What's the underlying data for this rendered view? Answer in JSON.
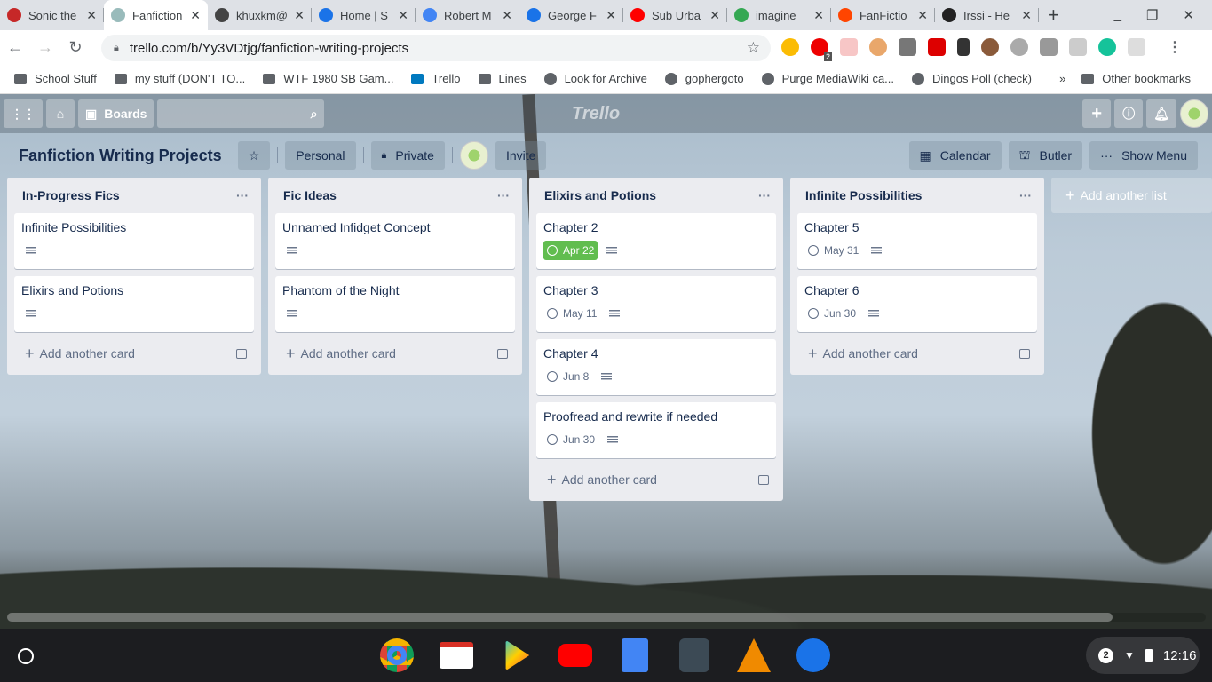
{
  "browser": {
    "tabs": [
      {
        "title": "Sonic the",
        "color": "#c62828"
      },
      {
        "title": "Fanfiction",
        "color": "#9bb",
        "active": true
      },
      {
        "title": "khuxkm@",
        "color": "#444"
      },
      {
        "title": "Home | S",
        "color": "#1a73e8"
      },
      {
        "title": "Robert M",
        "color": "#4285f4"
      },
      {
        "title": "George F",
        "color": "#1a73e8"
      },
      {
        "title": "Sub Urba",
        "color": "#ff0000"
      },
      {
        "title": "imagine",
        "color": "#34a853"
      },
      {
        "title": "FanFictio",
        "color": "#ff4500"
      },
      {
        "title": "Irssi - He",
        "color": "#222"
      }
    ],
    "url": "trello.com/b/Yy3VDtjg/fanfiction-writing-projects",
    "extension_badge": "2",
    "bookmarks": [
      {
        "label": "School Stuff",
        "icon": "folder-icon"
      },
      {
        "label": "my stuff (DON'T TO...",
        "icon": "folder-icon"
      },
      {
        "label": "WTF 1980 SB Gam...",
        "icon": "folder-icon"
      },
      {
        "label": "Trello",
        "icon": "trello-icon"
      },
      {
        "label": "Lines",
        "icon": "lines-icon"
      },
      {
        "label": "Look for Archive",
        "icon": "globe-icon"
      },
      {
        "label": "gophergoto",
        "icon": "globe-icon"
      },
      {
        "label": "Purge MediaWiki ca...",
        "icon": "globe-icon"
      },
      {
        "label": "Dingos Poll (check)",
        "icon": "globe-icon"
      }
    ],
    "overflow": "»",
    "other_bookmarks": "Other bookmarks"
  },
  "trello": {
    "boards_label": "Boards",
    "logo": "Trello",
    "board_title": "Fanfiction Writing Projects",
    "team": "Personal",
    "visibility": "Private",
    "invite": "Invite",
    "calendar": "Calendar",
    "butler": "Butler",
    "show_menu": "Show Menu",
    "add_card": "Add another card",
    "add_list": "Add another list",
    "lists": [
      {
        "title": "In-Progress Fics",
        "cards": [
          {
            "title": "Infinite Possibilities",
            "desc": true
          },
          {
            "title": "Elixirs and Potions",
            "desc": true
          }
        ]
      },
      {
        "title": "Fic Ideas",
        "cards": [
          {
            "title": "Unnamed Infidget Concept",
            "desc": true
          },
          {
            "title": "Phantom of the Night",
            "desc": true
          }
        ]
      },
      {
        "title": "Elixirs and Potions",
        "cards": [
          {
            "title": "Chapter 2",
            "due": "Apr 22",
            "due_complete": true,
            "desc": true
          },
          {
            "title": "Chapter 3",
            "due": "May 11",
            "desc": true
          },
          {
            "title": "Chapter 4",
            "due": "Jun 8",
            "desc": true
          },
          {
            "title": "Proofread and rewrite if needed",
            "due": "Jun 30",
            "desc": true
          }
        ]
      },
      {
        "title": "Infinite Possibilities",
        "cards": [
          {
            "title": "Chapter 5",
            "due": "May 31",
            "desc": true
          },
          {
            "title": "Chapter 6",
            "due": "Jun 30",
            "desc": true
          }
        ]
      }
    ]
  },
  "shelf": {
    "notifications": "2",
    "time": "12:16"
  },
  "colors": {
    "due_complete": "#61bd4f",
    "list_bg": "#ebecf0",
    "title": "#172b4d"
  }
}
